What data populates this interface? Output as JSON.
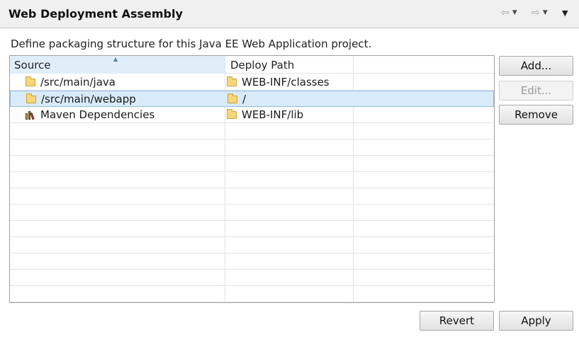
{
  "header": {
    "title": "Web Deployment Assembly",
    "back_icon": "back-arrow-icon",
    "forward_icon": "forward-arrow-icon",
    "menu_icon": "view-menu-icon"
  },
  "description": "Define packaging structure for this Java EE Web Application project.",
  "table": {
    "columns": [
      "Source",
      "Deploy Path"
    ],
    "rows": [
      {
        "source": "/src/main/java",
        "source_icon": "folder-icon",
        "deploy": "WEB-INF/classes",
        "deploy_icon": "folder-icon",
        "selected": false
      },
      {
        "source": "/src/main/webapp",
        "source_icon": "folder-icon",
        "deploy": "/",
        "deploy_icon": "folder-icon",
        "selected": true
      },
      {
        "source": "Maven Dependencies",
        "source_icon": "library-icon",
        "deploy": "WEB-INF/lib",
        "deploy_icon": "folder-icon",
        "selected": false
      }
    ]
  },
  "side_buttons": {
    "add": "Add...",
    "edit": "Edit...",
    "remove": "Remove"
  },
  "footer_buttons": {
    "revert": "Revert",
    "apply": "Apply"
  },
  "colors": {
    "header_bg": "#f0f0f0",
    "selection_bg": "#d9ebf9",
    "selection_border": "#8fbbe6",
    "sorted_header_bg": "#dfeef8"
  }
}
